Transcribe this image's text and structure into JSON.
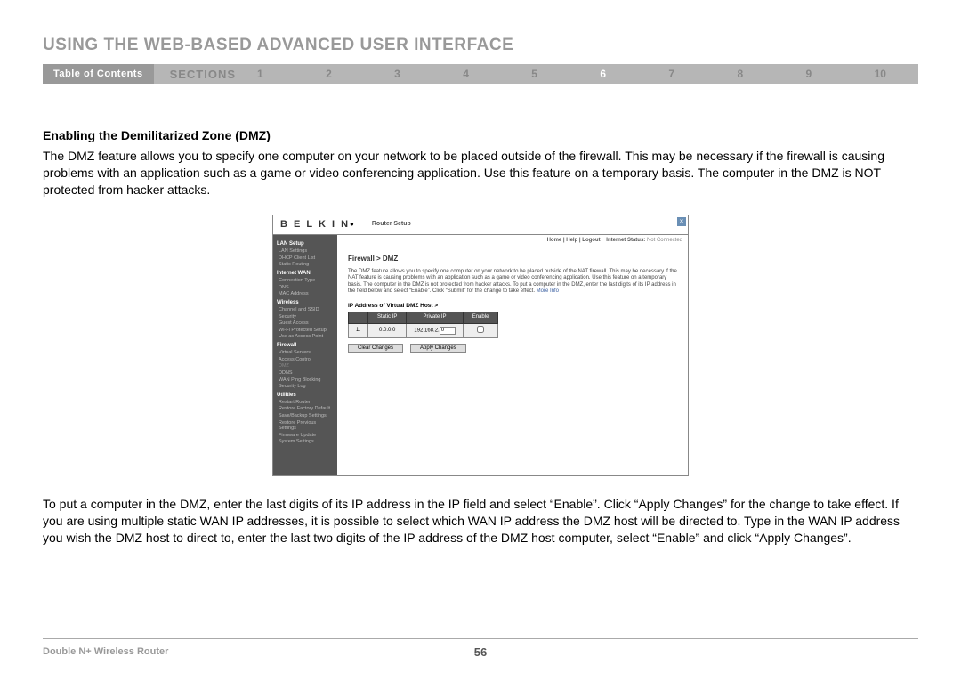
{
  "page_title": "USING THE WEB-BASED ADVANCED USER INTERFACE",
  "toc_label": "Table of Contents",
  "sections_label": "SECTIONS",
  "section_numbers": [
    "1",
    "2",
    "3",
    "4",
    "5",
    "6",
    "7",
    "8",
    "9",
    "10"
  ],
  "active_section": "6",
  "sub_heading": "Enabling the Demilitarized Zone (DMZ)",
  "para1": "The DMZ feature allows you to specify one computer on your network to be placed outside of the firewall. This may be necessary if the firewall is causing problems with an application such as a game or video conferencing application. Use this feature on a temporary basis. The computer in the DMZ is NOT protected from hacker attacks.",
  "para2": "To put a computer in the DMZ, enter the last digits of its IP address in the IP field and select “Enable”. Click “Apply Changes” for the change to take effect. If you are using multiple static WAN IP addresses, it is possible to select which WAN IP address the DMZ host will be directed to. Type in the WAN IP address you wish the DMZ host to direct to, enter the last two digits of the IP address of the DMZ host computer, select “Enable” and click “Apply Changes”.",
  "router": {
    "brand": "B E L K I N",
    "brand_dot": "●",
    "setup_label": "Router Setup",
    "topbar_links": "Home | Help | Logout",
    "status_label": "Internet Status:",
    "status_value": "Not Connected",
    "breadcrumb": "Firewall > DMZ",
    "desc": "The DMZ feature allows you to specify one computer on your network to be placed outside of the NAT firewall. This may be necessary if the NAT feature is causing problems with an application such as a game or video conferencing application. Use this feature on a temporary basis. The computer in the DMZ is not protected from hacker attacks. To put a computer in the DMZ, enter the last digits of its IP address in the field below and select “Enable”. Click “Submit” for the change to take effect.",
    "more_info": "More Info",
    "ip_label": "IP Address of Virtual DMZ Host >",
    "table": {
      "headers": [
        "",
        "Static IP",
        "Private IP",
        "Enable"
      ],
      "row_num": "1.",
      "static_ip": "0.0.0.0",
      "private_prefix": "192.168.2.",
      "private_value": "0"
    },
    "clear_btn": "Clear Changes",
    "apply_btn": "Apply Changes",
    "sidebar": {
      "lan_setup": "LAN Setup",
      "lan_items": [
        "LAN Settings",
        "DHCP Client List",
        "Static Routing"
      ],
      "internet_wan": "Internet WAN",
      "wan_items": [
        "Connection Type",
        "DNS",
        "MAC Address"
      ],
      "wireless": "Wireless",
      "wireless_items": [
        "Channel and SSID",
        "Security",
        "Guest Access",
        "Wi-Fi Protected Setup",
        "Use as Access Point"
      ],
      "firewall": "Firewall",
      "firewall_items": [
        "Virtual Servers",
        "Access Control",
        "DMZ",
        "DDNS",
        "WAN Ping Blocking",
        "Security Log"
      ],
      "utilities": "Utilities",
      "util_items": [
        "Restart Router",
        "Restore Factory Default",
        "Save/Backup Settings",
        "Restore Previous Settings",
        "Firmware Update",
        "System Settings"
      ]
    }
  },
  "footer_product": "Double N+ Wireless Router",
  "page_number": "56"
}
